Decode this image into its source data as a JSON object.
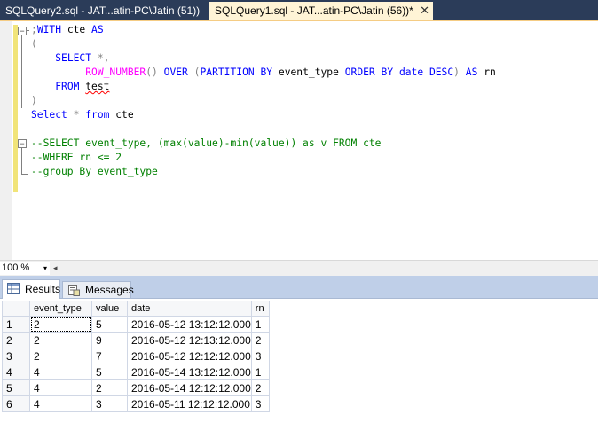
{
  "tabs": [
    {
      "label": "SQLQuery2.sql - JAT...atin-PC\\Jatin (51))",
      "active": false
    },
    {
      "label": "SQLQuery1.sql - JAT...atin-PC\\Jatin (56))*",
      "active": true,
      "close": "✕"
    }
  ],
  "editor": {
    "lines": [
      [
        {
          "t": ";",
          "c": "gr"
        },
        {
          "t": "WITH ",
          "c": "kw"
        },
        {
          "t": "cte ",
          "c": "id"
        },
        {
          "t": "AS",
          "c": "kw"
        }
      ],
      [
        {
          "t": "(",
          "c": "gr"
        }
      ],
      [
        {
          "t": "    ",
          "c": "id"
        },
        {
          "t": "SELECT",
          "c": "kw"
        },
        {
          "t": " *,",
          "c": "gr"
        }
      ],
      [
        {
          "t": "         ",
          "c": "id"
        },
        {
          "t": "ROW_NUMBER",
          "c": "fn"
        },
        {
          "t": "() ",
          "c": "gr"
        },
        {
          "t": "OVER ",
          "c": "kw"
        },
        {
          "t": "(",
          "c": "gr"
        },
        {
          "t": "PARTITION BY ",
          "c": "kw"
        },
        {
          "t": "event_type ",
          "c": "id"
        },
        {
          "t": "ORDER BY ",
          "c": "kw"
        },
        {
          "t": "date ",
          "c": "kw"
        },
        {
          "t": "DESC",
          "c": "kw"
        },
        {
          "t": ") ",
          "c": "gr"
        },
        {
          "t": "AS ",
          "c": "kw"
        },
        {
          "t": "rn",
          "c": "id"
        }
      ],
      [
        {
          "t": "    ",
          "c": "id"
        },
        {
          "t": "FROM ",
          "c": "kw"
        },
        {
          "t": "test",
          "c": "id squig"
        }
      ],
      [
        {
          "t": ")",
          "c": "gr"
        }
      ],
      [
        {
          "t": "Select ",
          "c": "kw"
        },
        {
          "t": "* ",
          "c": "gr"
        },
        {
          "t": "from ",
          "c": "kw"
        },
        {
          "t": "cte",
          "c": "id"
        }
      ],
      [
        {
          "t": "",
          "c": "id"
        }
      ],
      [
        {
          "t": "--SELECT event_type, (max(value)-min(value)) as v FROM cte",
          "c": "cm"
        }
      ],
      [
        {
          "t": "--WHERE rn <= 2",
          "c": "cm"
        }
      ],
      [
        {
          "t": "--group By event_type",
          "c": "cm"
        }
      ]
    ]
  },
  "zoom": {
    "value": "100 %",
    "dropdown_icon": "▾",
    "scroll_left_icon": "◂"
  },
  "result_tabs": [
    {
      "label": "Results",
      "icon": "grid-icon",
      "active": true
    },
    {
      "label": "Messages",
      "icon": "messages-icon",
      "active": false
    }
  ],
  "grid": {
    "columns": [
      "event_type",
      "value",
      "date",
      "rn"
    ],
    "rows": [
      {
        "n": "1",
        "cells": [
          "2",
          "5",
          "2016-05-12 13:12:12.000",
          "1"
        ]
      },
      {
        "n": "2",
        "cells": [
          "2",
          "9",
          "2016-05-12 12:13:12.000",
          "2"
        ]
      },
      {
        "n": "3",
        "cells": [
          "2",
          "7",
          "2016-05-12 12:12:12.000",
          "3"
        ]
      },
      {
        "n": "4",
        "cells": [
          "4",
          "5",
          "2016-05-14 13:12:12.000",
          "1"
        ]
      },
      {
        "n": "5",
        "cells": [
          "4",
          "2",
          "2016-05-14 12:12:12.000",
          "2"
        ]
      },
      {
        "n": "6",
        "cells": [
          "4",
          "3",
          "2016-05-11 12:12:12.000",
          "3"
        ]
      }
    ]
  }
}
